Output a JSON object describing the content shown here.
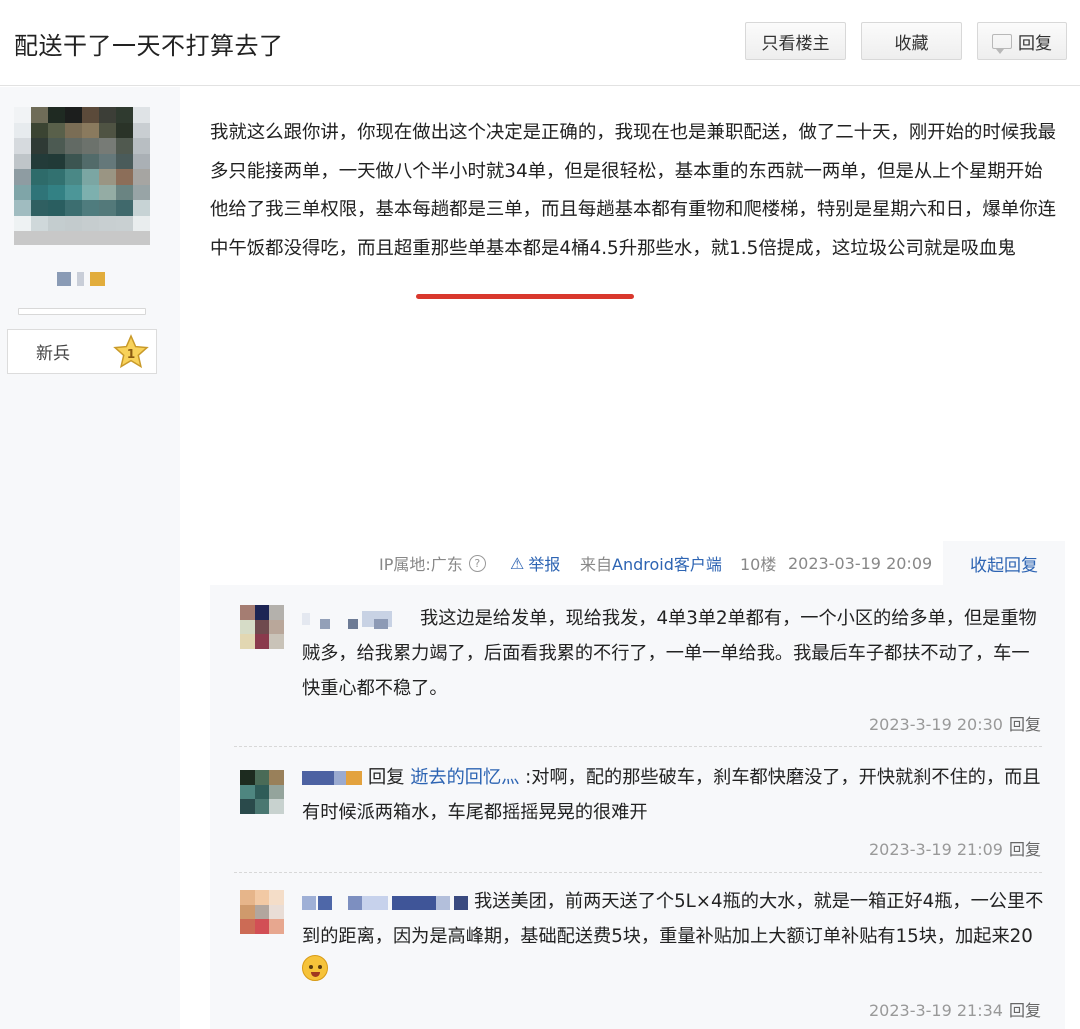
{
  "header": {
    "title": "配送干了一天不打算去了",
    "buttons": {
      "only_op": "只看楼主",
      "favorite": "收藏",
      "reply": "回复"
    }
  },
  "author": {
    "badge_label": "新兵",
    "badge_level": "1"
  },
  "post": {
    "body": "我就这么跟你讲，你现在做出这个决定是正确的，我现在也是兼职配送，做了二十天，刚开始的时候我最多只能接两单，一天做八个半小时就34单，但是很轻松，基本重的东西就一两单，但是从上个星期开始他给了我三单权限，基本每趟都是三单，而且每趟基本都有重物和爬楼梯，特别是星期六和日，爆单你连中午饭都没得吃，而且超重那些单基本都是4桶4.5升那些水，就1.5倍提成，这垃圾公司就是吸血鬼",
    "meta": {
      "ip_location": "IP属地:广东",
      "report": "举报",
      "client_prefix": "来自",
      "client": "Android客户端",
      "floor": "10楼",
      "date": "2023-03-19 20:09"
    },
    "collapse_label": "收起回复"
  },
  "replies": [
    {
      "text": "我这边是给发单，现给我发，4单3单2单都有，一个小区的给多单，但是重物贼多，给我累力竭了，后面看我累的不行了，一单一单给我。我最后车子都扶不动了，车一快重心都不稳了。",
      "time": "2023-3-19 20:30",
      "reply_label": "回复"
    },
    {
      "prefix": "回复",
      "target": "逝去的回忆灬",
      "text": ":对啊，配的那些破车，刹车都快磨没了，开快就刹不住的，而且有时候派两箱水，车尾都摇摇晃晃的很难开",
      "time": "2023-3-19 21:09",
      "reply_label": "回复"
    },
    {
      "text": "我送美团，前两天送了个5L×4瓶的大水，就是一箱正好4瓶，一公里不到的距离，因为是高峰期，基础配送费5块，重量补贴加上大额订单补贴有15块，加起来20",
      "time": "2023-3-19 21:34",
      "reply_label": "回复"
    }
  ],
  "colors": {
    "link": "#2d64b3",
    "underline": "#d9382d",
    "panel_bg": "#f7f8fa"
  }
}
